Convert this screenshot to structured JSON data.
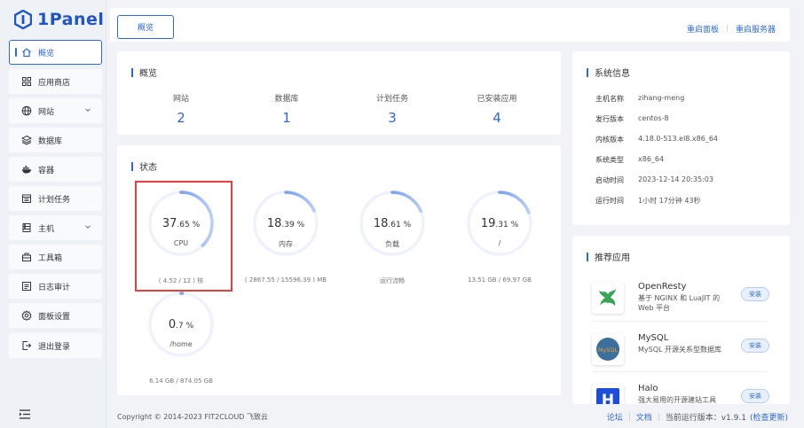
{
  "brand": {
    "name": "1Panel"
  },
  "sidebar": {
    "items": [
      {
        "label": "概览",
        "icon": "home-icon",
        "active": true
      },
      {
        "label": "应用商店",
        "icon": "apps-grid-icon"
      },
      {
        "label": "网站",
        "icon": "globe-icon",
        "expandable": true
      },
      {
        "label": "数据库",
        "icon": "layers-icon"
      },
      {
        "label": "容器",
        "icon": "docker-icon"
      },
      {
        "label": "计划任务",
        "icon": "schedule-icon"
      },
      {
        "label": "主机",
        "icon": "host-icon",
        "expandable": true
      },
      {
        "label": "工具箱",
        "icon": "toolbox-icon"
      },
      {
        "label": "日志审计",
        "icon": "log-icon"
      },
      {
        "label": "面板设置",
        "icon": "gear-icon"
      },
      {
        "label": "退出登录",
        "icon": "logout-icon"
      }
    ]
  },
  "topbar": {
    "tab": "概览",
    "restart_panel": "重启面板",
    "restart_server": "重启服务器"
  },
  "overview": {
    "title": "概览",
    "stats": [
      {
        "label": "网站",
        "value": "2"
      },
      {
        "label": "数据库",
        "value": "1"
      },
      {
        "label": "计划任务",
        "value": "3"
      },
      {
        "label": "已安装应用",
        "value": "4"
      }
    ]
  },
  "status": {
    "title": "状态",
    "gauges": [
      {
        "int": "37",
        "dec": ".65",
        "name": "CPU",
        "foot": "( 4.52 / 12 ) 核",
        "percent": 37.65
      },
      {
        "int": "18",
        "dec": ".39",
        "name": "内存",
        "foot": "( 2867.55 / 15596.39 ) MB",
        "percent": 18.39
      },
      {
        "int": "18",
        "dec": ".61",
        "name": "负载",
        "foot": "运行流畅",
        "percent": 18.61
      },
      {
        "int": "19",
        "dec": ".31",
        "name": "/",
        "foot": "13.51 GB / 69.97 GB",
        "percent": 19.31
      },
      {
        "int": "0",
        "dec": ".7",
        "name": "/home",
        "foot": "6.14 GB / 874.05 GB",
        "percent": 0.7
      }
    ],
    "unit": "%"
  },
  "sysinfo": {
    "title": "系统信息",
    "rows": [
      {
        "k": "主机名称",
        "v": "zihang-meng"
      },
      {
        "k": "发行版本",
        "v": "centos-8"
      },
      {
        "k": "内核版本",
        "v": "4.18.0-513.el8.x86_64"
      },
      {
        "k": "系统类型",
        "v": "x86_64"
      },
      {
        "k": "启动时间",
        "v": "2023-12-14 20:35:03"
      },
      {
        "k": "运行时间",
        "v": "1小时 17分钟 43秒"
      }
    ]
  },
  "recommend": {
    "title": "推荐应用",
    "apps": [
      {
        "name": "OpenResty",
        "desc": "基于 NGINX 和 LuaJIT 的 Web 平台",
        "btn": "安装",
        "icon": "openresty-logo"
      },
      {
        "name": "MySQL",
        "desc": "MySQL 开源关系型数据库",
        "btn": "安装",
        "icon": "mysql-logo",
        "logo_text": "MySQL"
      },
      {
        "name": "Halo",
        "desc": "强大易用的开源建站工具",
        "btn": "安装",
        "icon": "halo-logo",
        "logo_text": "H"
      }
    ]
  },
  "footer": {
    "copyright": "Copyright © 2014-2023 FIT2CLOUD 飞致云",
    "forum": "论坛",
    "docs": "文档",
    "version_label": "当前运行版本：v1.9.1",
    "check_update": "(检查更新)"
  },
  "colors": {
    "accent": "#2f68db",
    "highlight": "#e53e3e"
  }
}
